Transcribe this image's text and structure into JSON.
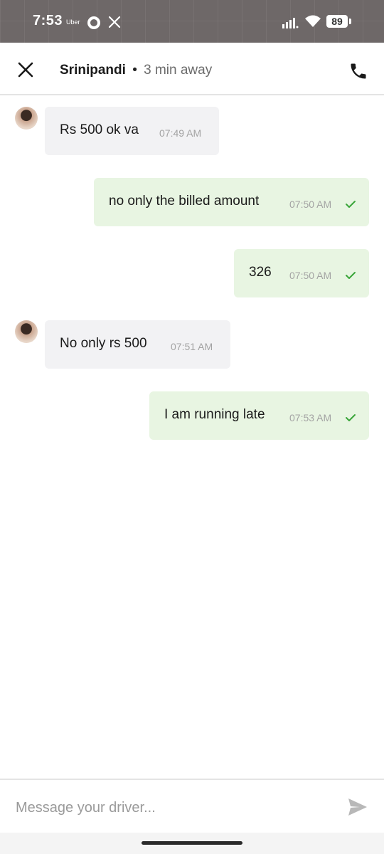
{
  "status_bar": {
    "time": "7:53",
    "uber_label": "Uber",
    "battery": "89"
  },
  "header": {
    "driver_name": "Srinipandi",
    "separator": "•",
    "eta": "3 min away"
  },
  "messages": [
    {
      "direction": "in",
      "text": "Rs 500 ok va",
      "time": "07:49 AM"
    },
    {
      "direction": "out",
      "text": "no only the billed amount",
      "time": "07:50 AM"
    },
    {
      "direction": "out",
      "text": "326",
      "time": "07:50 AM"
    },
    {
      "direction": "in",
      "text": "No only rs 500",
      "time": "07:51 AM"
    },
    {
      "direction": "out",
      "text": "I am running late",
      "time": "07:53 AM"
    }
  ],
  "composer": {
    "placeholder": "Message your driver...",
    "value": ""
  },
  "colors": {
    "incoming_bubble": "#f2f2f4",
    "outgoing_bubble": "#e8f5e2",
    "check_green": "#3aa53a"
  }
}
